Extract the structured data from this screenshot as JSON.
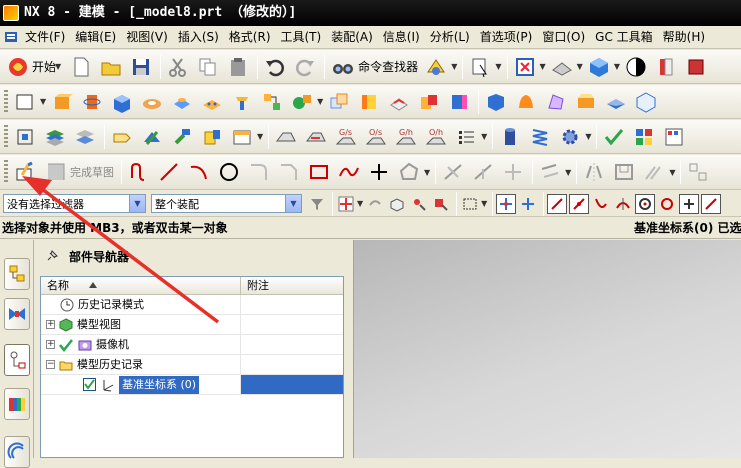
{
  "window": {
    "title": "NX 8 - 建模 - [_model8.prt （修改的）]"
  },
  "menu": [
    "文件(F)",
    "编辑(E)",
    "视图(V)",
    "插入(S)",
    "格式(R)",
    "工具(T)",
    "装配(A)",
    "信息(I)",
    "分析(L)",
    "首选项(P)",
    "窗口(O)",
    "GC 工具箱",
    "帮助(H)"
  ],
  "toolbar1": {
    "start_label": "开始",
    "command_finder_label": "命令查找器"
  },
  "sketch_toolbar": {
    "finish_sketch_label": "完成草图"
  },
  "selection_bar": {
    "filter_value": "没有选择过滤器",
    "scope_value": "整个装配"
  },
  "status": {
    "prompt": "选择对象并使用 MB3，或者双击某一对象",
    "right_text": "基准坐标系(0) 已选"
  },
  "navigator": {
    "title": "部件导航器",
    "columns": {
      "name": "名称",
      "note": "附注"
    },
    "rows": [
      {
        "label": "历史记录模式",
        "note": ""
      },
      {
        "label": "模型视图",
        "note": ""
      },
      {
        "label": "摄像机",
        "note": ""
      },
      {
        "label": "模型历史记录",
        "note": ""
      },
      {
        "label": "基准坐标系 (0)",
        "note": ""
      }
    ]
  },
  "colors": {
    "accent": "#316ac5",
    "annotation_arrow": "#e8302a"
  }
}
